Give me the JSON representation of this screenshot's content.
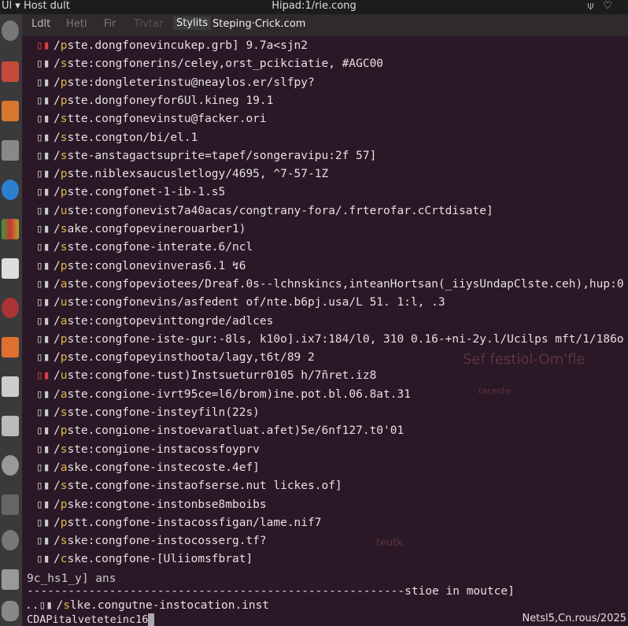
{
  "topbar": {
    "menu": "Ul ▾",
    "app": "Host dult",
    "title": "Hipad:1/rie.cong",
    "icons": [
      "accessibility-icon",
      "heart-icon"
    ]
  },
  "tabs": [
    "Ldlt",
    "Heti",
    "Fir",
    "Tivtar",
    "Stylits",
    "Steping·Crick.com"
  ],
  "lines": [
    [
      "p",
      "ste.dongfonevincukep.grb] 9.7a<sjn2"
    ],
    [
      "s",
      "ste:congfonerins/celey,orst_pcikciatie, #AGC00"
    ],
    [
      "p",
      "ste:dongleterinstu@neaylos.er/slfpy?"
    ],
    [
      "p",
      "ste.dongfoneyfor6Ul.kineg 19.1"
    ],
    [
      "s",
      "tte.congfonevinstu@facker.ori"
    ],
    [
      "s",
      "ste.congton/bi/el.1"
    ],
    [
      "s",
      "ste-anstagactsuprite=tapef/songeravipu:2f 57]"
    ],
    [
      "p",
      "ste.niblexsaucusletlogy/4695, ^7-57-1Z"
    ],
    [
      "p",
      "ste.congfonet-1-ib-1.s5"
    ],
    [
      "u",
      "ste:congfonevist7a40acas/congtrany-fora/.frterofar.cCrtdisate]"
    ],
    [
      "s",
      "ake.congfopevinerouarber1)"
    ],
    [
      "s",
      "ste.congfone-interate.6/ncl"
    ],
    [
      "p",
      "ste:conglonevinveras6.1 ↯6"
    ],
    [
      "a",
      "ste.congfopeviotees/Dreaf.0s--lchnskincs,inteanHortsan(_iiysUndapClste.ceh),hup:0"
    ],
    [
      "u",
      "ste:congfonevins/asfedent of/nte.b6pj.usa/L 51. 1:l, .3"
    ],
    [
      "a",
      "ste:congtopevinttongrde/adlces"
    ],
    [
      "p",
      "ste:congfone-iste-gur:-8ls, k10o].ix7:184/l0, 310 0.16-+ni-2y.l/Ucilps mft/1/186o"
    ],
    [
      "p",
      "ste.congfopeyinsthoota/lagy,t6t/89   2"
    ],
    [
      "u",
      "ste:congfone-tust)Instsueturr0105 h/7ñret.iz8"
    ],
    [
      "a",
      "ste.congione-ivrt95ce=l6/brom)ine.pot.bl.06.8at.31"
    ],
    [
      "s",
      "ste.congfone-insteyfiln(22s)"
    ],
    [
      "p",
      "ste.congione-instoevaratluat.afet)5e/6nf127.t0'01"
    ],
    [
      "s",
      "ste:congione-instacossfoyprv"
    ],
    [
      "a",
      "ske.congfone-instecoste.4ef]"
    ],
    [
      "s",
      "ste.congfone-instaofserse.nut  lickes.of]"
    ],
    [
      "p",
      "ske:congtone-instonbse8mboibs"
    ],
    [
      "p",
      "stt.congfone-instacossfigan/lame.nif7"
    ],
    [
      "s",
      "ske:congfone-instocosserg.tf?"
    ],
    [
      "c",
      "ske.congfone-[Uliiomsfbrat]"
    ]
  ],
  "prompt1": "9c_hs1_y] ans",
  "divider": "-------------------------------------------------------stioe in moutce]",
  "last_line": [
    "s",
    "lke.congutne-instocation.inst"
  ],
  "prompt2": "CDAPitalveteteinc16",
  "status": "Netsl5,Cn.rous/2025",
  "ghosts": [
    "Sef  festiol-Om'fle",
    "taceste",
    "teutk"
  ]
}
